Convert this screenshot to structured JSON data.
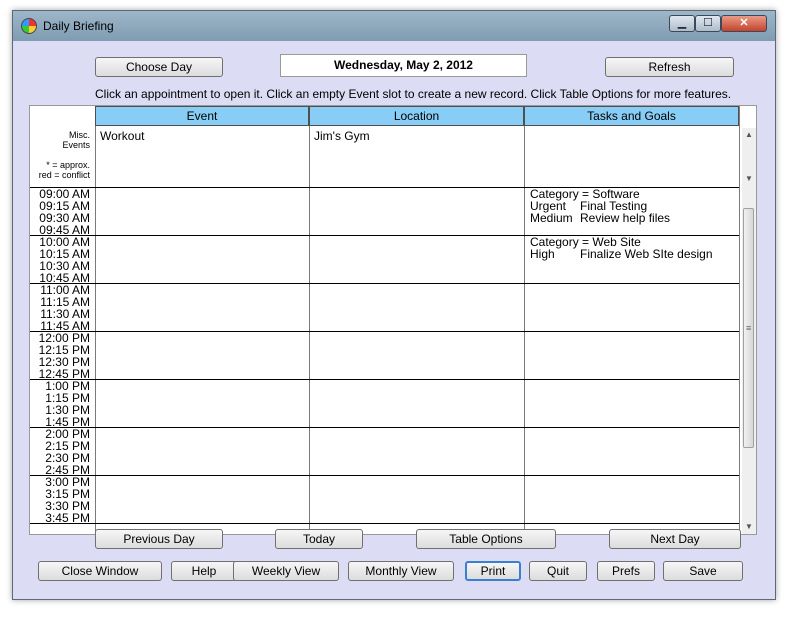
{
  "window": {
    "title": "Daily Briefing",
    "controls": {
      "minimize": "▁",
      "maximize": "☐",
      "close": "✕"
    }
  },
  "header": {
    "choose_day": "Choose Day",
    "date": "Wednesday, May 2, 2012",
    "refresh": "Refresh",
    "instruction": "Click an appointment to open it. Click an empty Event slot to create a new record. Click Table Options for more features."
  },
  "table": {
    "columns": [
      "Event",
      "Location",
      "Tasks and Goals"
    ],
    "misc_label_1": "Misc.",
    "misc_label_2": "Events",
    "legend_1": "* = approx.",
    "legend_2": "red = conflict",
    "misc_event": "Workout",
    "misc_location": "Jim's Gym",
    "time_blocks": [
      [
        "09:00 AM",
        "09:15 AM",
        "09:30 AM",
        "09:45 AM"
      ],
      [
        "10:00 AM",
        "10:15 AM",
        "10:30 AM",
        "10:45 AM"
      ],
      [
        "11:00 AM",
        "11:15 AM",
        "11:30 AM",
        "11:45 AM"
      ],
      [
        "12:00 PM",
        "12:15 PM",
        "12:30 PM",
        "12:45 PM"
      ],
      [
        "1:00 PM",
        "1:15 PM",
        "1:30 PM",
        "1:45 PM"
      ],
      [
        "2:00 PM",
        "2:15 PM",
        "2:30 PM",
        "2:45 PM"
      ],
      [
        "3:00 PM",
        "3:15 PM",
        "3:30 PM",
        "3:45 PM"
      ]
    ],
    "task_groups": [
      {
        "category": "Category = Software",
        "items": [
          {
            "priority": "Urgent",
            "task": "Final Testing"
          },
          {
            "priority": "Medium",
            "task": "Review help files"
          }
        ]
      },
      {
        "category": "Category = Web Site",
        "items": [
          {
            "priority": "High",
            "task": "Finalize Web SIte design"
          }
        ]
      }
    ]
  },
  "nav": {
    "previous_day": "Previous Day",
    "today": "Today",
    "table_options": "Table Options",
    "next_day": "Next Day"
  },
  "footer": {
    "close_window": "Close Window",
    "help": "Help",
    "weekly_view": "Weekly View",
    "monthly_view": "Monthly View",
    "print": "Print",
    "quit": "Quit",
    "prefs": "Prefs",
    "save": "Save"
  }
}
